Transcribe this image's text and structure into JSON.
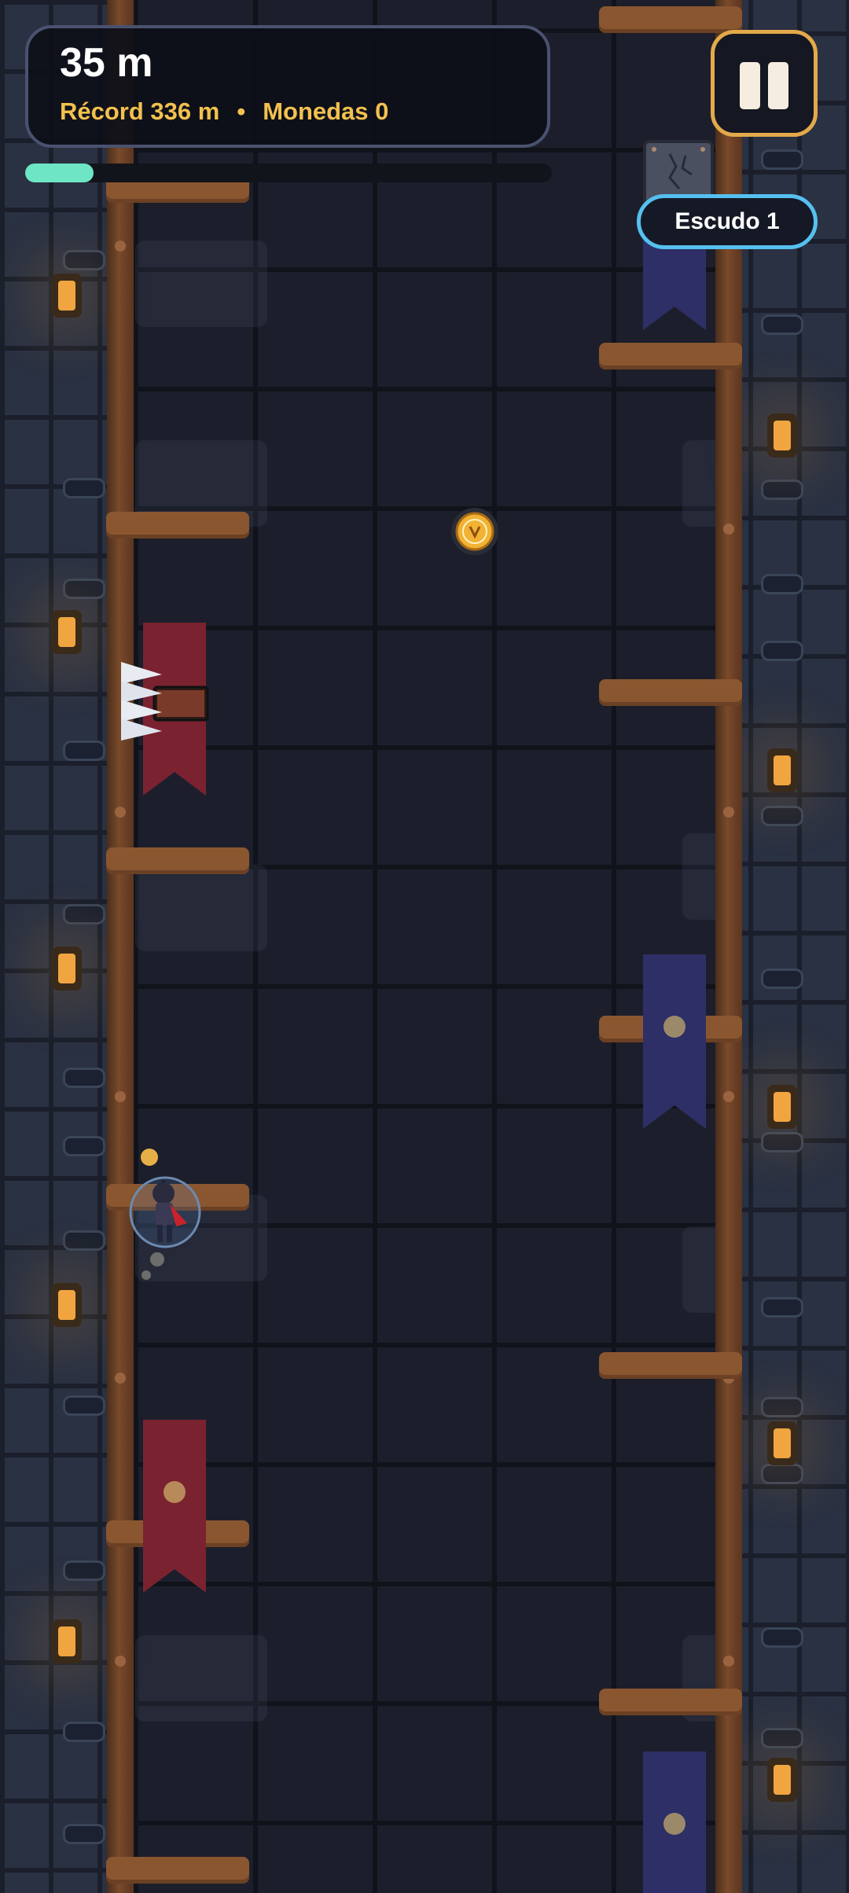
{
  "hud": {
    "distance": "35 m",
    "record": "Récord 336 m",
    "separator": "•",
    "coins": "Monedas 0",
    "progress": 0.13
  },
  "pause": {
    "icon": "pause-icon"
  },
  "shield_badge": {
    "label": "Escudo 1"
  },
  "colors": {
    "accent": "#f2c14e",
    "progress": "#6ee6c6",
    "shield": "#55c0ef",
    "pause_border": "#e3a94a",
    "red_banner": "#7a2230",
    "blue_banner": "#2e2f66"
  },
  "entities": {
    "coin": "coin-icon",
    "player": "ninja-player",
    "spikes": "wall-spikes",
    "crate": "stone-block"
  }
}
